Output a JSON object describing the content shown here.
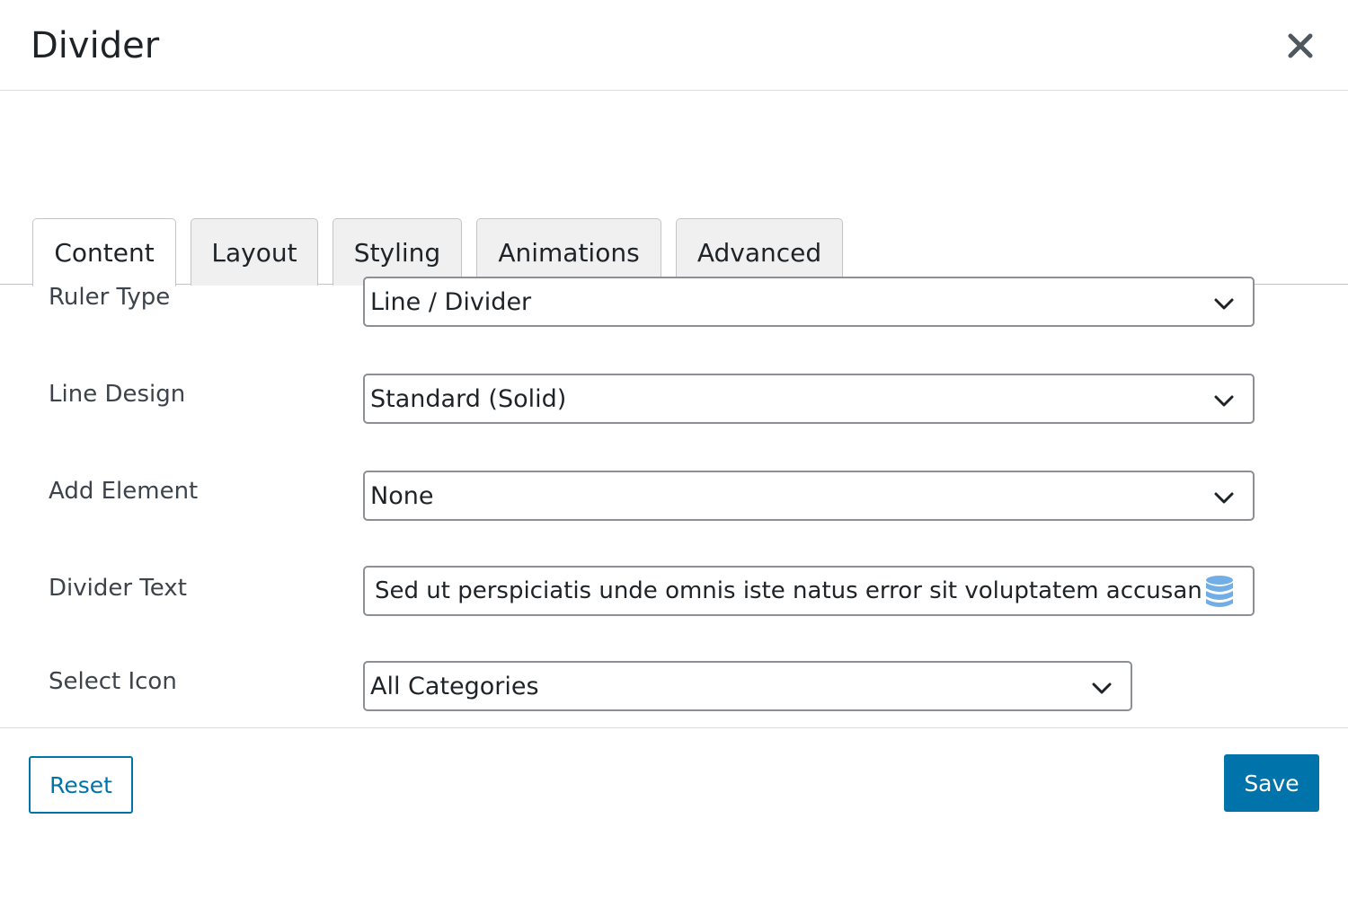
{
  "dialog": {
    "title": "Divider"
  },
  "tabs": [
    {
      "label": "Content",
      "active": true
    },
    {
      "label": "Layout",
      "active": false
    },
    {
      "label": "Styling",
      "active": false
    },
    {
      "label": "Animations",
      "active": false
    },
    {
      "label": "Advanced",
      "active": false
    }
  ],
  "fields": {
    "ruler_type": {
      "label": "Ruler Type",
      "value": "Line / Divider"
    },
    "line_design": {
      "label": "Line Design",
      "value": "Standard (Solid)"
    },
    "add_element": {
      "label": "Add Element",
      "value": "None"
    },
    "divider_text": {
      "label": "Divider Text",
      "value": "Sed ut perspiciatis unde omnis iste natus error sit voluptatem accusantium"
    },
    "select_icon": {
      "label": "Select Icon",
      "value": "All Categories"
    }
  },
  "footer": {
    "reset_label": "Reset",
    "save_label": "Save"
  },
  "colors": {
    "accent": "#0073aa",
    "db_icon": "#72aee6"
  },
  "icons": {
    "close": "close-icon",
    "dropdown": "chevron-down-icon",
    "dynamic_data": "database-icon"
  }
}
